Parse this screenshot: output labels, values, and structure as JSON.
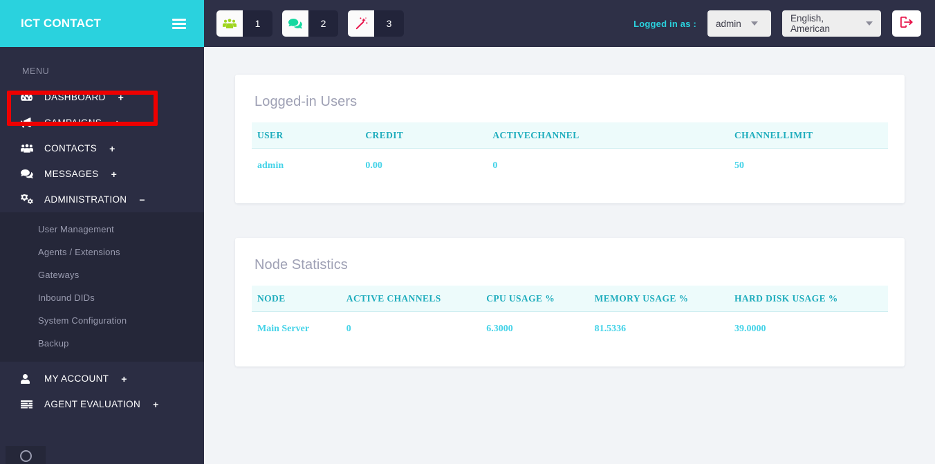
{
  "brand": {
    "title": "ICT CONTACT",
    "menu_icon": "hamburger-icon"
  },
  "sidebar": {
    "section_label": "MENU",
    "items": [
      {
        "label": "DASHBOARD",
        "icon": "dashboard-gauge-icon",
        "toggle": "+"
      },
      {
        "label": "CAMPAIGNS",
        "icon": "bullhorn-icon",
        "toggle": "+"
      },
      {
        "label": "CONTACTS",
        "icon": "users-icon",
        "toggle": "+"
      },
      {
        "label": "MESSAGES",
        "icon": "comments-icon",
        "toggle": "+"
      },
      {
        "label": "ADMINISTRATION",
        "icon": "cogs-icon",
        "toggle": "−"
      }
    ],
    "submenu": [
      {
        "label": "User Management"
      },
      {
        "label": "Agents / Extensions"
      },
      {
        "label": "Gateways"
      },
      {
        "label": "Inbound DIDs"
      },
      {
        "label": "System Configuration"
      },
      {
        "label": "Backup"
      }
    ],
    "items_bottom": [
      {
        "label": "MY ACCOUNT",
        "icon": "user-icon",
        "toggle": "+"
      },
      {
        "label": "AGENT EVALUATION",
        "icon": "list-bars-icon",
        "toggle": "+"
      }
    ]
  },
  "topbar": {
    "badges": [
      {
        "icon": "users-group-icon",
        "count": "1",
        "color": "#9fd51f"
      },
      {
        "icon": "chat-bubbles-icon",
        "count": "2",
        "color": "#16d8a0"
      },
      {
        "icon": "magic-wand-icon",
        "count": "3",
        "color": "#e8134a"
      }
    ],
    "logged_in_label": "Logged in as :",
    "user_dropdown": "admin",
    "language_dropdown": "English, American",
    "logout_icon": "logout-icon"
  },
  "cards": [
    {
      "title": "Logged-in Users",
      "columns": [
        "USER",
        "CREDIT",
        "ACTIVECHANNEL",
        "CHANNELLIMIT"
      ],
      "rows": [
        [
          "admin",
          "0.00",
          "0",
          "50"
        ]
      ]
    },
    {
      "title": "Node Statistics",
      "columns": [
        "NODE",
        "ACTIVE CHANNELS",
        "CPU USAGE %",
        "MEMORY USAGE %",
        "HARD DISK USAGE %"
      ],
      "rows": [
        [
          "Main Server",
          "0",
          "6.3000",
          "81.5336",
          "39.0000"
        ]
      ]
    }
  ],
  "colors": {
    "brand_teal": "#2ad2de",
    "sidebar_bg": "#2b2d43",
    "submenu_bg": "#252739",
    "topbar_bg": "#2e3047",
    "page_bg": "#f2f4f7",
    "table_header_text": "#1fadbd",
    "table_cell_text": "#45d3e8",
    "annotation_red": "#ee0000"
  }
}
